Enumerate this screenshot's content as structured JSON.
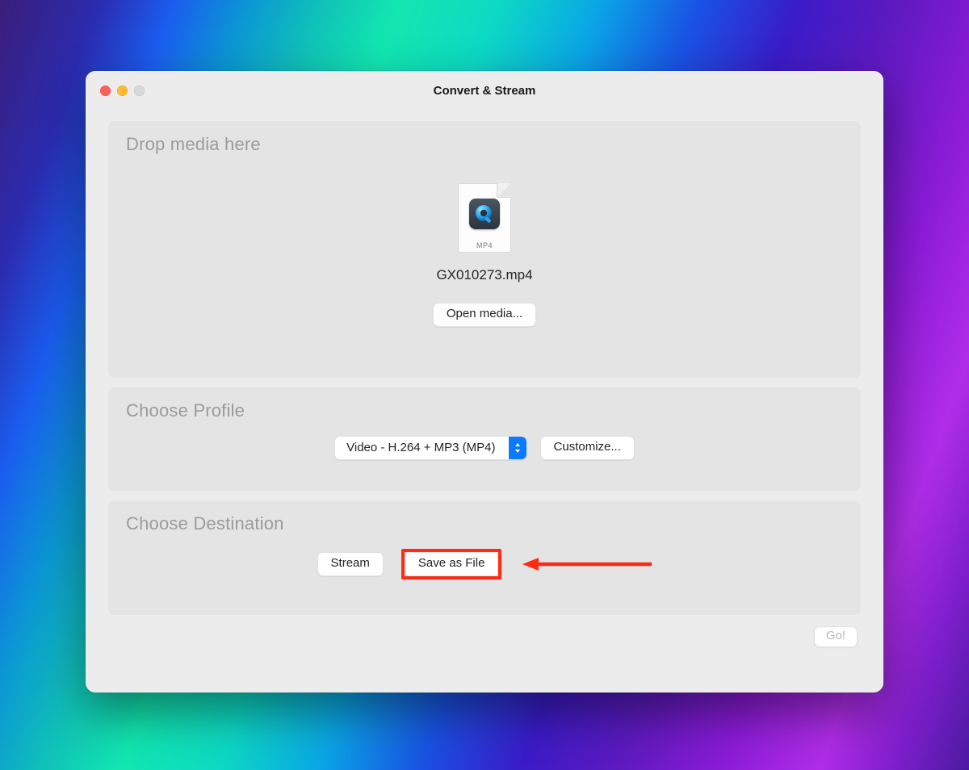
{
  "window": {
    "title": "Convert & Stream"
  },
  "drop": {
    "heading": "Drop media here",
    "file_ext_label": "MP4",
    "filename": "GX010273.mp4",
    "open_media_label": "Open media..."
  },
  "profile": {
    "heading": "Choose Profile",
    "selected": "Video - H.264 + MP3 (MP4)",
    "customize_label": "Customize..."
  },
  "destination": {
    "heading": "Choose Destination",
    "stream_label": "Stream",
    "save_as_file_label": "Save as File"
  },
  "footer": {
    "go_label": "Go!"
  },
  "annotation": {
    "highlight_color": "#ff2a12"
  }
}
